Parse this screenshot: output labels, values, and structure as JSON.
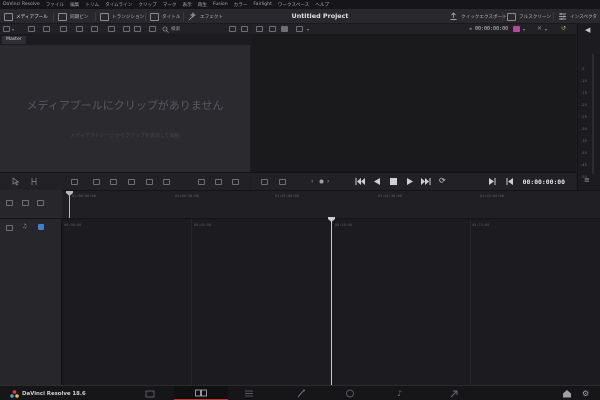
{
  "menu": {
    "items": [
      "DaVinci Resolve",
      "ファイル",
      "編集",
      "トリム",
      "タイムライン",
      "クリップ",
      "マーク",
      "表示",
      "再生",
      "Fusion",
      "カラー",
      "Fairlight",
      "ワークスペース",
      "ヘルプ"
    ]
  },
  "toolbar": {
    "media_pool": "メディアプール",
    "sync_bin": "同期ビン",
    "transitions": "トランジション",
    "titles": "タイトル",
    "effects": "エフェクト",
    "project_title": "Untitled Project",
    "quick_export": "クイックエクスポート",
    "fullscreen": "フルスクリーン",
    "inspector": "インスペクタ"
  },
  "pool_tools": {
    "search_label": "検索"
  },
  "viewer_tools": {
    "timecode": "00:00:00:00"
  },
  "bins": {
    "master": "Master"
  },
  "media_pool": {
    "empty_title": "メディアプールにクリップがありません",
    "empty_subtitle": "メディアストレージからクリップを追加して開始"
  },
  "meters": {
    "labels": [
      "-5",
      "-10",
      "-15",
      "-20",
      "-25",
      "-30",
      "-35",
      "-40",
      "-45",
      "-50"
    ]
  },
  "transport": {
    "timecode": "00:00:00:00"
  },
  "ruler": {
    "timecodes": [
      "01:00:00:00",
      "01:00:30:00",
      "01:01:00:00",
      "01:01:30:00",
      "01:02:00:00"
    ]
  },
  "track_ruler": {
    "timecodes": [
      "00:00:00",
      "00:05:00",
      "00:10:00",
      "00:15:00"
    ]
  },
  "pagebar": {
    "brand": "DaVinci Resolve 18.6"
  },
  "colors": {
    "accent_red": "#c23030",
    "background": "#1e1e22",
    "panel": "#2a2a2f"
  }
}
